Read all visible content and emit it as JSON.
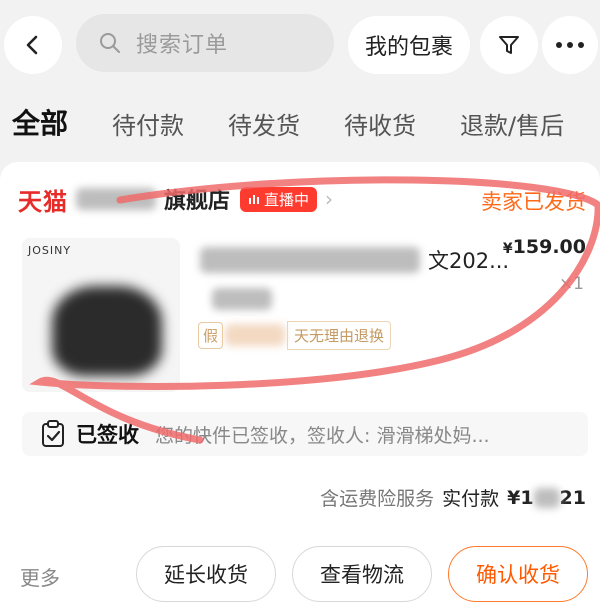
{
  "search": {
    "placeholder": "搜索订单"
  },
  "header": {
    "packages_label": "我的包裹"
  },
  "tabs": [
    {
      "label": "全部"
    },
    {
      "label": "待付款"
    },
    {
      "label": "待发货"
    },
    {
      "label": "待收货"
    },
    {
      "label": "退款/售后"
    }
  ],
  "order": {
    "store_brand": "天猫",
    "store_suffix": "旗舰店",
    "live_badge": "直播中",
    "status": "卖家已发货",
    "product_brand": "JOSINY",
    "title_visible": "文202...",
    "price_symbol": "¥",
    "price": "159.00",
    "quantity": "×1",
    "tag_prefix": "假",
    "tag_text": "天无理由退换",
    "signed_label": "已签收",
    "signed_desc": "您的快件已签收，签收人: 滑滑梯处妈...",
    "pay_service": "含运费险服务",
    "pay_label": "实付款",
    "pay_amount": "¥1",
    "pay_amount_tail": "21"
  },
  "actions": {
    "more": "更多",
    "extend": "延长收货",
    "logistics": "查看物流",
    "confirm": "确认收货"
  },
  "colors": {
    "accent": "#ff6a1a",
    "tmall": "#e62b28",
    "live": "#ff3b30",
    "annotation": "#f06b6b"
  }
}
